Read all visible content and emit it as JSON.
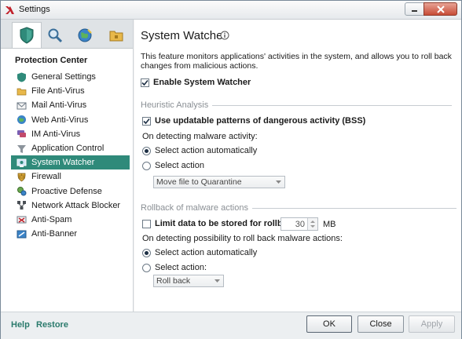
{
  "window": {
    "title": "Settings"
  },
  "left": {
    "tabs": [
      {
        "name": "protection",
        "icon": "shield-icon"
      },
      {
        "name": "scan",
        "icon": "magnifier-icon"
      },
      {
        "name": "update",
        "icon": "globe-icon"
      },
      {
        "name": "options",
        "icon": "folder-icon"
      }
    ],
    "section_title": "Protection Center",
    "items": [
      {
        "label": "General Settings",
        "icon": "shield-small-icon"
      },
      {
        "label": "File Anti-Virus",
        "icon": "folder-small-icon"
      },
      {
        "label": "Mail Anti-Virus",
        "icon": "envelope-icon"
      },
      {
        "label": "Web Anti-Virus",
        "icon": "globe-small-icon"
      },
      {
        "label": "IM Anti-Virus",
        "icon": "chat-icon"
      },
      {
        "label": "Application Control",
        "icon": "funnel-icon"
      },
      {
        "label": "System Watcher",
        "icon": "monitor-icon"
      },
      {
        "label": "Firewall",
        "icon": "firewall-icon"
      },
      {
        "label": "Proactive Defense",
        "icon": "gears-icon"
      },
      {
        "label": "Network Attack Blocker",
        "icon": "network-icon"
      },
      {
        "label": "Anti-Spam",
        "icon": "spam-icon"
      },
      {
        "label": "Anti-Banner",
        "icon": "banner-icon"
      }
    ],
    "selected_index": 6
  },
  "main": {
    "title": "System Watcher",
    "description": "This feature monitors applications' activities in the system, and allows you to roll back changes from malicious actions.",
    "enable_label": "Enable System Watcher",
    "heuristic": {
      "group_label": "Heuristic Analysis",
      "use_patterns_label": "Use updatable patterns of dangerous activity (BSS)",
      "on_detect_label": "On detecting malware activity:",
      "auto_label": "Select action automatically",
      "manual_label": "Select action",
      "action_value": "Move file to Quarantine"
    },
    "rollback": {
      "group_label": "Rollback of malware actions",
      "limit_label": "Limit data to be stored for rollback:",
      "limit_value": "30",
      "limit_unit": "MB",
      "on_detect_label": "On detecting possibility to roll back malware actions:",
      "auto_label": "Select action automatically",
      "manual_label": "Select action:",
      "action_value": "Roll back"
    }
  },
  "footer": {
    "help": "Help",
    "restore": "Restore",
    "ok": "OK",
    "close": "Close",
    "apply": "Apply"
  }
}
